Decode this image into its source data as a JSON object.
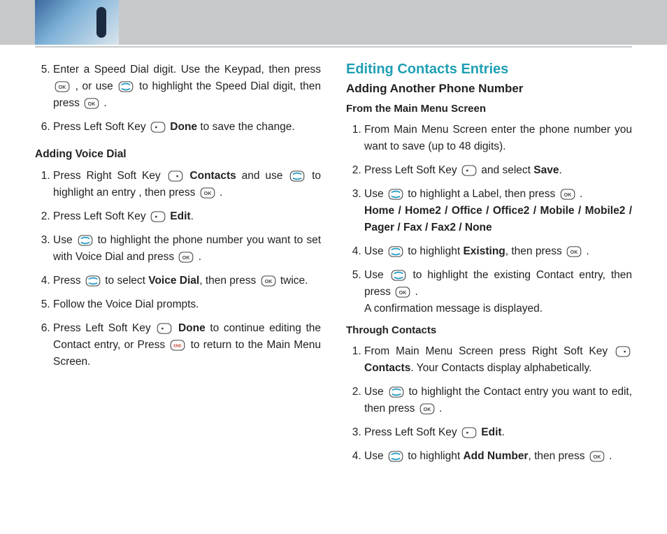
{
  "left": {
    "cont": [
      {
        "a": "Enter a Speed Dial digit. Use the Keypad, then press ",
        "b": ", or use ",
        "c": " to highlight the Speed Dial digit, then press ",
        "d": "."
      },
      {
        "a": "Press Left Soft Key ",
        "b": "Done",
        "c": " to save the change."
      }
    ],
    "voice": {
      "heading": "Adding Voice Dial",
      "steps": [
        {
          "a": "Press Right Soft Key ",
          "b": "Contacts",
          "c": " and use ",
          "d": " to highlight an entry , then press ",
          "e": "."
        },
        {
          "a": "Press Left Soft Key ",
          "b": "Edit",
          "c": "."
        },
        {
          "a": "Use ",
          "b": " to highlight the phone number you want to set with Voice Dial and press ",
          "c": "."
        },
        {
          "a": "Press ",
          "b": " to select ",
          "c": "Voice Dial",
          "d": ", then press ",
          "e": " twice."
        },
        {
          "a": "Follow the Voice Dial prompts."
        },
        {
          "a": "Press Left Soft Key ",
          "b": "Done",
          "c": " to continue editing the Contact entry, or Press ",
          "d": " to return to the Main Menu Screen."
        }
      ]
    }
  },
  "right": {
    "section": "Editing Contacts Entries",
    "sub": "Adding Another Phone Number",
    "mainmenu": {
      "heading": "From the Main Menu Screen",
      "steps": [
        {
          "a": "From Main Menu Screen enter the phone number you want to save (up to 48 digits)."
        },
        {
          "a": "Press Left Soft Key ",
          "b": " and select ",
          "c": "Save",
          "d": "."
        },
        {
          "a": "Use ",
          "b": " to highlight a Label, then press ",
          "c": ".",
          "d": "Home / Home2 / Office / Office2 / Mobile / Mobile2 / Pager / Fax / Fax2 / None"
        },
        {
          "a": "Use ",
          "b": " to highlight ",
          "c": "Existing",
          "d": ", then press ",
          "e": "."
        },
        {
          "a": "Use ",
          "b": " to highlight the existing Contact entry, then press ",
          "c": ".",
          "d": "A confirmation message is displayed."
        }
      ]
    },
    "through": {
      "heading": "Through Contacts",
      "steps": [
        {
          "a": "From Main Menu Screen press Right Soft Key ",
          "b": "Contacts",
          "c": ". Your Contacts display alphabetically."
        },
        {
          "a": "Use ",
          "b": " to highlight the Contact entry you want to edit, then press ",
          "c": "."
        },
        {
          "a": "Press Left Soft Key ",
          "b": "Edit",
          "c": "."
        },
        {
          "a": "Use ",
          "b": " to highlight ",
          "c": "Add Number",
          "d": ", then press ",
          "e": "."
        }
      ]
    }
  }
}
